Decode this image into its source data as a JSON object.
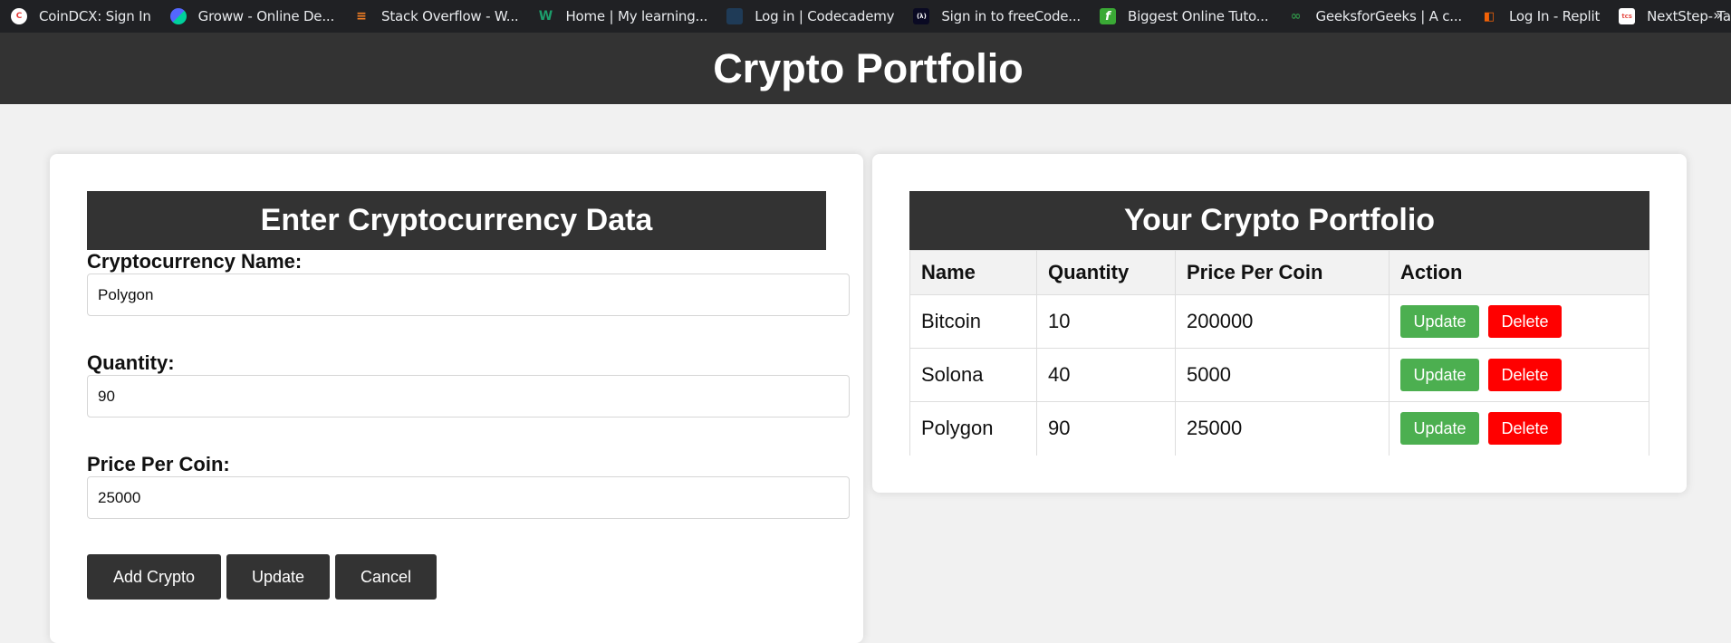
{
  "bookmarks": [
    {
      "label": "CoinDCX: Sign In",
      "icon": "coindcx-icon",
      "color": "#e53935",
      "glyph": "C"
    },
    {
      "label": "Groww - Online De...",
      "icon": "groww-icon",
      "color": "#5367ff",
      "glyph": ""
    },
    {
      "label": "Stack Overflow - W...",
      "icon": "stackoverflow-icon",
      "color": "#f48024",
      "glyph": "≡"
    },
    {
      "label": "Home | My learning...",
      "icon": "w-logo-icon",
      "color": "#1c9d6b",
      "glyph": "W"
    },
    {
      "label": "Log in | Codecademy",
      "icon": "codecademy-icon",
      "color": "#1f3b57",
      "glyph": ""
    },
    {
      "label": "Sign in to freeCode...",
      "icon": "freecodecamp-icon",
      "color": "#0a0a23",
      "glyph": "(λ)"
    },
    {
      "label": "Biggest Online Tuto...",
      "icon": "tutorial-site-icon",
      "color": "#3aa935",
      "glyph": "f"
    },
    {
      "label": "GeeksforGeeks | A c...",
      "icon": "geeksforgeeks-icon",
      "color": "#2f8d46",
      "glyph": "∞"
    },
    {
      "label": "Log In - Replit",
      "icon": "replit-icon",
      "color": "#f26207",
      "glyph": "◧"
    },
    {
      "label": "NextStep- Tata Con...",
      "icon": "tcs-icon",
      "color": "#e6504a",
      "glyph": "tcs"
    }
  ],
  "app": {
    "title": "Crypto Portfolio"
  },
  "form": {
    "title": "Enter Cryptocurrency Data",
    "name_label": "Cryptocurrency Name:",
    "name_value": "Polygon",
    "quantity_label": "Quantity:",
    "quantity_value": "90",
    "price_label": "Price Per Coin:",
    "price_value": "25000",
    "add_label": "Add Crypto",
    "update_label": "Update",
    "cancel_label": "Cancel"
  },
  "portfolio": {
    "title": "Your Crypto Portfolio",
    "columns": [
      "Name",
      "Quantity",
      "Price Per Coin",
      "Action"
    ],
    "rows": [
      {
        "name": "Bitcoin",
        "quantity": "10",
        "price": "200000"
      },
      {
        "name": "Solona",
        "quantity": "40",
        "price": "5000"
      },
      {
        "name": "Polygon",
        "quantity": "90",
        "price": "25000"
      }
    ],
    "update_label": "Update",
    "delete_label": "Delete"
  },
  "colors": {
    "header": "#333333",
    "update": "#4caf50",
    "delete": "#ff0000"
  }
}
